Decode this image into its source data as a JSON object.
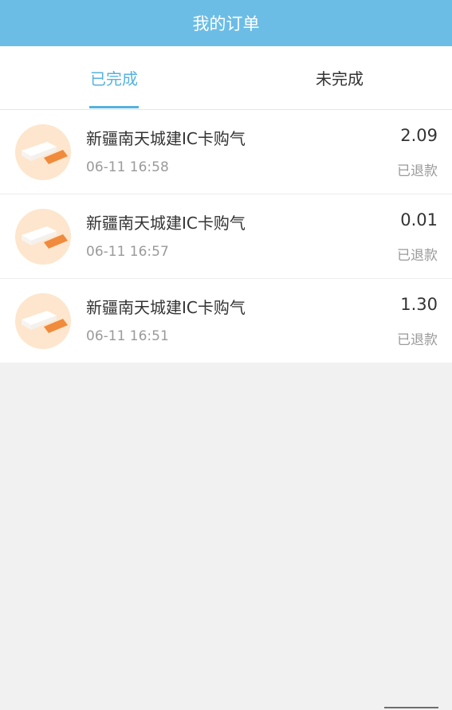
{
  "header": {
    "title": "我的订单"
  },
  "tabs": [
    {
      "label": "已完成",
      "active": true
    },
    {
      "label": "未完成",
      "active": false
    }
  ],
  "orders": [
    {
      "icon": "gas-card-icon",
      "title": "新疆南天城建IC卡购气",
      "time": "06-11 16:58",
      "amount": "2.09",
      "status": "已退款"
    },
    {
      "icon": "gas-card-icon",
      "title": "新疆南天城建IC卡购气",
      "time": "06-11 16:57",
      "amount": "0.01",
      "status": "已退款"
    },
    {
      "icon": "gas-card-icon",
      "title": "新疆南天城建IC卡购气",
      "time": "06-11 16:51",
      "amount": "1.30",
      "status": "已退款"
    }
  ],
  "colors": {
    "header_bg": "#6cbde6",
    "accent": "#56b2de",
    "page_bg": "#f1f1f1",
    "icon_circle": "#fde6cd",
    "icon_orange": "#f08a3c"
  }
}
